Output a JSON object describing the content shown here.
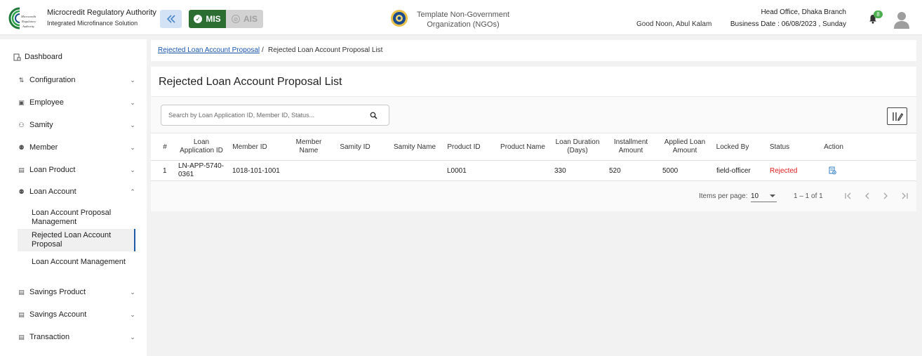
{
  "header": {
    "org_name": "Microcredit Regulatory Authority",
    "org_subtitle": "Integrated Microfinance Solution",
    "logo_text": [
      "Microcredit",
      "Regulatory",
      "Authority"
    ],
    "mode_mis": "MIS",
    "mode_ais": "AIS",
    "ngo_name_line1": "Template Non-Government",
    "ngo_name_line2": "Organization (NGOs)",
    "greeting": "Good Noon, Abul Kalam",
    "branch": "Head Office, Dhaka Branch",
    "business_date": "Business Date : 06/08/2023 , Sunday",
    "notification_count": "8",
    "accent_color": "#2c6e31"
  },
  "sidebar": {
    "dashboard": "Dashboard",
    "items": [
      {
        "label": "Configuration",
        "icon": "sliders-icon",
        "expanded": false
      },
      {
        "label": "Employee",
        "icon": "employee-icon",
        "expanded": false
      },
      {
        "label": "Samity",
        "icon": "group-icon",
        "expanded": false
      },
      {
        "label": "Member",
        "icon": "members-icon",
        "expanded": false
      },
      {
        "label": "Loan Product",
        "icon": "document-icon",
        "expanded": false
      },
      {
        "label": "Loan Account",
        "icon": "members-icon",
        "expanded": true
      },
      {
        "label": "Savings Product",
        "icon": "document-icon",
        "expanded": false
      },
      {
        "label": "Savings Account",
        "icon": "document-icon",
        "expanded": false
      },
      {
        "label": "Transaction",
        "icon": "document-icon",
        "expanded": false
      }
    ],
    "loan_account_sub": [
      {
        "line1": "Loan Account Proposal",
        "line2": "Management"
      },
      {
        "line1": "Rejected Loan Account",
        "line2": "Proposal"
      },
      {
        "line1": "Loan Account Management",
        "line2": ""
      }
    ]
  },
  "breadcrumb": {
    "link": "Rejected Loan Account Proposal",
    "separator": "/",
    "current": "Rejected Loan Account Proposal List"
  },
  "page": {
    "title": "Rejected Loan Account Proposal List",
    "search_placeholder": "Search by Loan Application ID, Member ID, Status..."
  },
  "table": {
    "headers": [
      [
        "#",
        ""
      ],
      [
        "Loan",
        "Application ID"
      ],
      [
        "Member ID",
        ""
      ],
      [
        "Member",
        "Name"
      ],
      [
        "Samity ID",
        ""
      ],
      [
        "Samity Name",
        ""
      ],
      [
        "Product ID",
        ""
      ],
      [
        "Product Name",
        ""
      ],
      [
        "Loan Duration",
        "(Days)"
      ],
      [
        "Installment",
        "Amount"
      ],
      [
        "Applied Loan",
        "Amount"
      ],
      [
        "Locked By",
        ""
      ],
      [
        "Status",
        ""
      ],
      [
        "Action",
        ""
      ]
    ],
    "rows": [
      {
        "index": "1",
        "loan_app_id_line1": "LN-APP-5740-",
        "loan_app_id_line2": "0361",
        "member_id": "1018-101-1001",
        "member_name": "",
        "samity_id": "",
        "samity_name": "",
        "product_id": "L0001",
        "product_name": "",
        "loan_duration": "330",
        "installment_amount": "520",
        "applied_amount": "5000",
        "locked_by": "field-officer",
        "status": "Rejected",
        "status_color": "#e01b1b"
      }
    ]
  },
  "pagination": {
    "items_per_page_label": "Items per page:",
    "items_per_page": "10",
    "range": "1 – 1 of 1"
  }
}
